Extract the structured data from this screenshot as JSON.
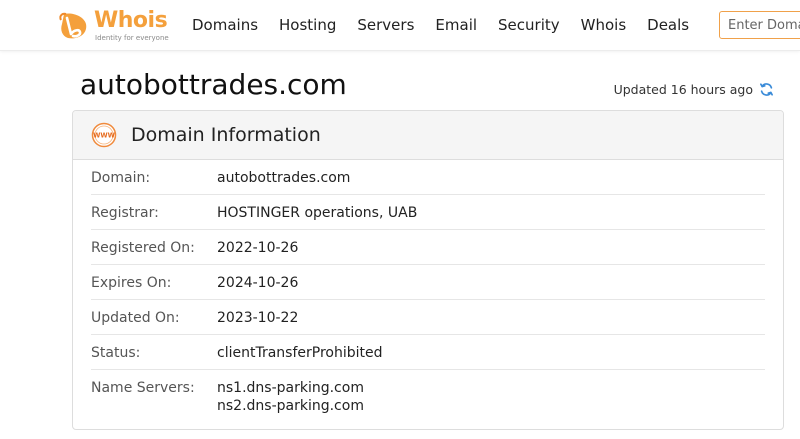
{
  "header": {
    "logo_text": "Whois",
    "logo_tagline": "Identity for everyone",
    "nav": [
      "Domains",
      "Hosting",
      "Servers",
      "Email",
      "Security",
      "Whois",
      "Deals"
    ],
    "search_placeholder": "Enter Domain"
  },
  "page": {
    "title": "autobottrades.com",
    "updated_text": "Updated 16 hours ago"
  },
  "card": {
    "title": "Domain Information",
    "icon_text": "WWW",
    "rows": [
      {
        "label": "Domain:",
        "value": "autobottrades.com"
      },
      {
        "label": "Registrar:",
        "value": "HOSTINGER operations, UAB"
      },
      {
        "label": "Registered On:",
        "value": "2022-10-26"
      },
      {
        "label": "Expires On:",
        "value": "2024-10-26"
      },
      {
        "label": "Updated On:",
        "value": "2023-10-22"
      },
      {
        "label": "Status:",
        "value": "clientTransferProhibited"
      }
    ],
    "name_servers": {
      "label": "Name Servers:",
      "values": [
        "ns1.dns-parking.com",
        "ns2.dns-parking.com"
      ]
    }
  },
  "colors": {
    "brand_orange": "#f4a03c",
    "refresh_blue": "#3a8bd8"
  }
}
